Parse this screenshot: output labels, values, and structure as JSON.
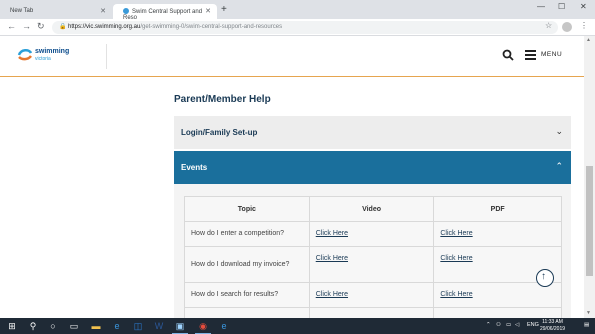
{
  "browser": {
    "tabs": [
      {
        "label": "New Tab",
        "active": false
      },
      {
        "label": "Swim Central Support and Reso",
        "active": true
      }
    ],
    "url_host": "https://vic.swimming.org.au",
    "url_path": "/get-swimming-0/swim-central-support-and-resources"
  },
  "header": {
    "logo_line1": "swimming",
    "logo_line2": "victoria",
    "menu_label": "MENU"
  },
  "main": {
    "title": "Parent/Member Help",
    "accordions": [
      {
        "label": "Login/Family Set-up",
        "expanded": false
      },
      {
        "label": "Events",
        "expanded": true
      }
    ],
    "table": {
      "columns": [
        "Topic",
        "Video",
        "PDF"
      ],
      "rows": [
        {
          "topic": "How do I enter a competition?",
          "video": "Click Here",
          "pdf": "Click Here"
        },
        {
          "topic": "How do I download my invoice?",
          "video": "Click Here",
          "pdf": "Click Here"
        },
        {
          "topic": "How do I search for results?",
          "video": "Click Here",
          "pdf": "Click Here"
        }
      ]
    }
  },
  "taskbar": {
    "language": "ENG",
    "time": "11:33 AM",
    "date": "29/06/2019"
  },
  "colors": {
    "accent_blue": "#1a6f9c",
    "header_rule": "#e6a54f",
    "heading_navy": "#1a3a55"
  }
}
